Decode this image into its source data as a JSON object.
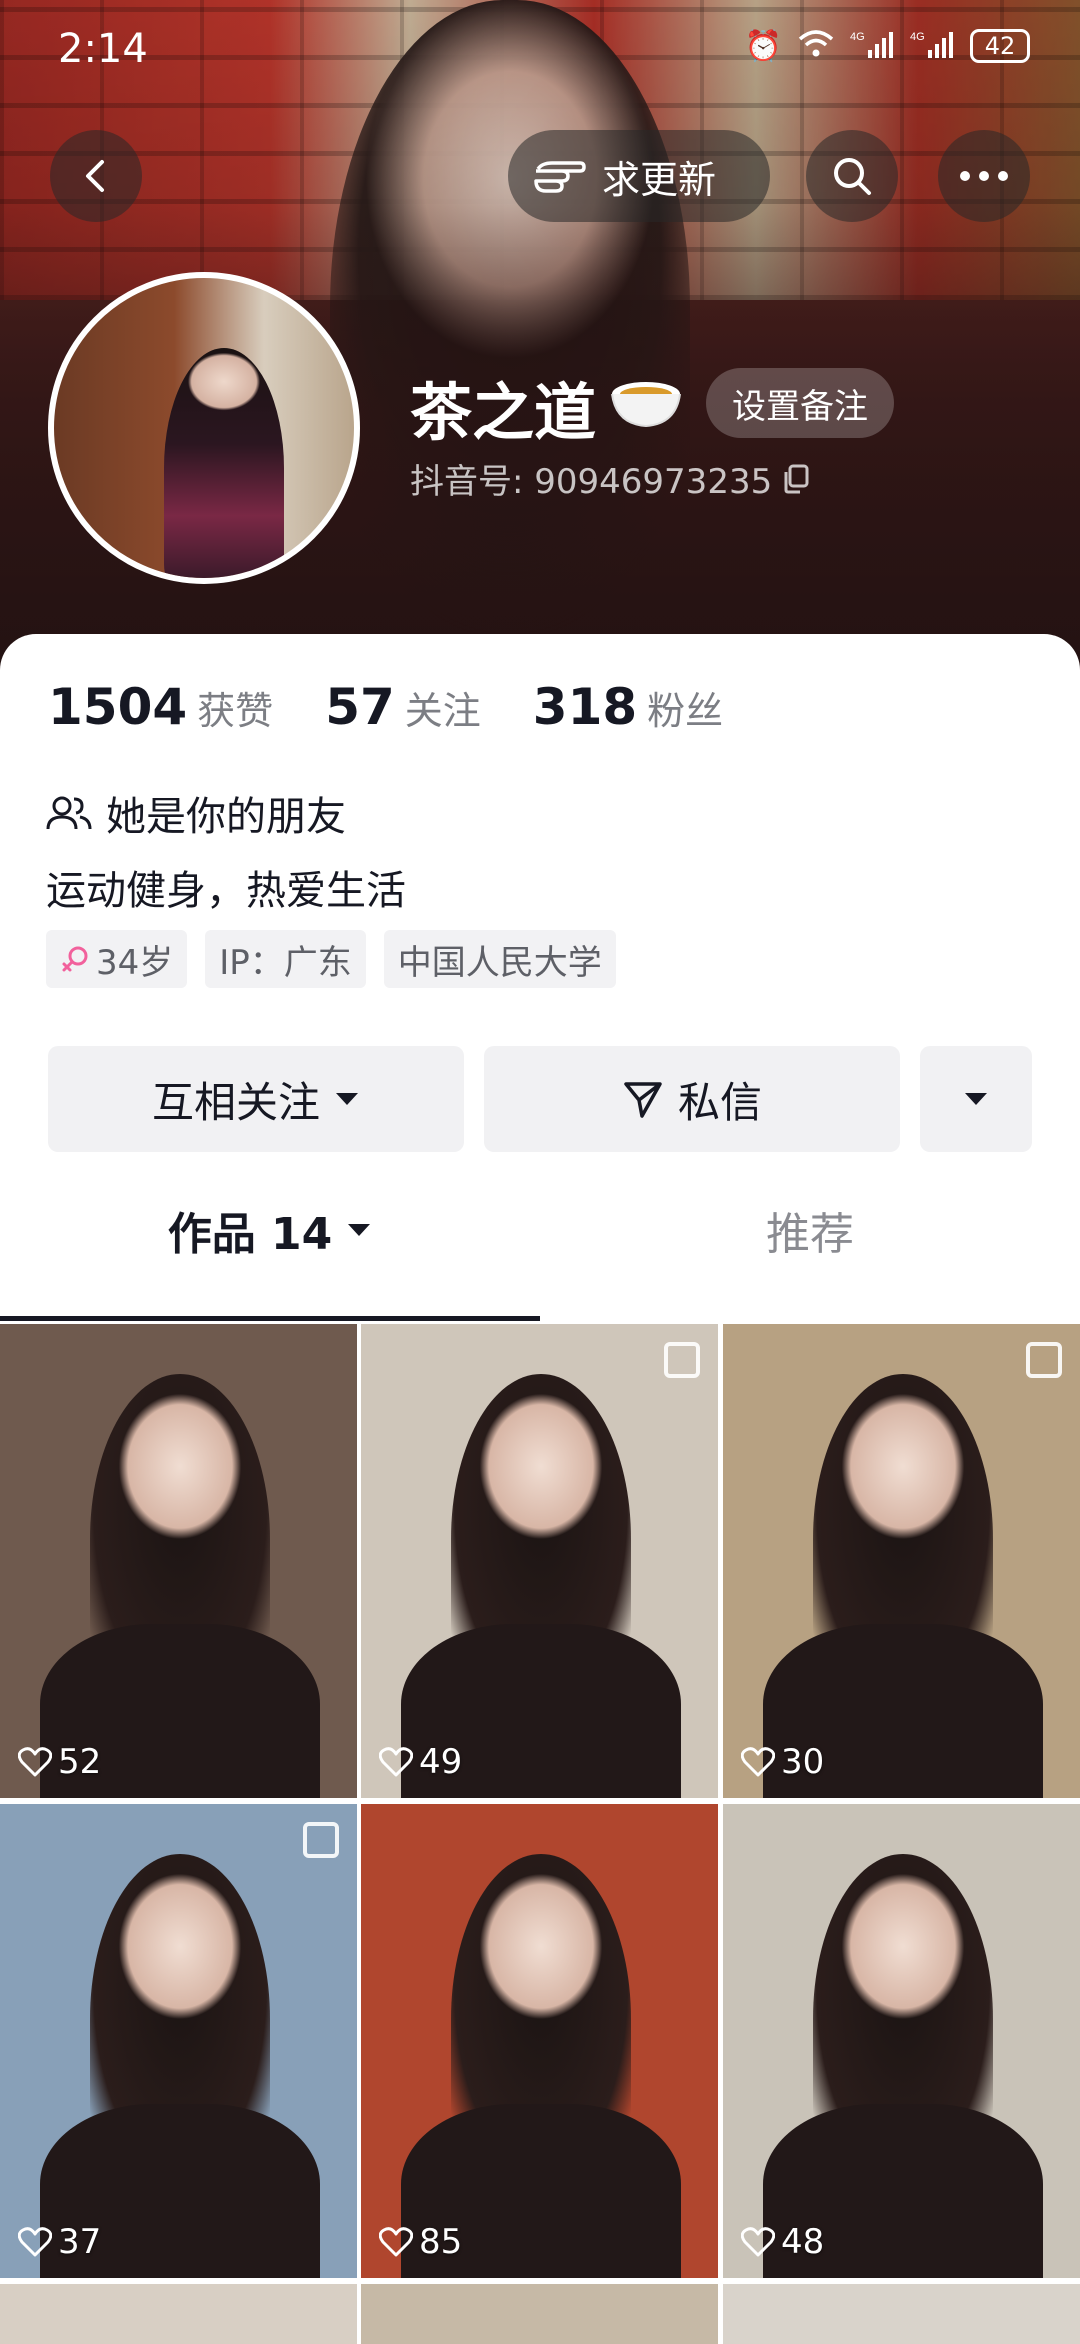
{
  "status_bar": {
    "time": "2:14",
    "battery": "42",
    "signal1": "4G",
    "signal2": "4G"
  },
  "nav": {
    "update_label": "求更新"
  },
  "profile": {
    "nickname": "茶之道",
    "remark_label": "设置备注",
    "douyin_id": "抖音号: 90946973235"
  },
  "stats": [
    {
      "value": "1504",
      "label": "获赞"
    },
    {
      "value": "57",
      "label": "关注"
    },
    {
      "value": "318",
      "label": "粉丝"
    }
  ],
  "friend_text": "她是你的朋友",
  "bio": "运动健身，热爱生活",
  "tags": {
    "age": "34岁",
    "ip": "IP：广东",
    "school": "中国人民大学"
  },
  "actions": {
    "follow": "互相关注",
    "message": "私信"
  },
  "tabs": {
    "works": "作品 14",
    "recommend": "推荐"
  },
  "grid": [
    {
      "likes": "52",
      "bg": "#6f5a4e"
    },
    {
      "likes": "49",
      "bg": "#cfc6ba"
    },
    {
      "likes": "30",
      "bg": "#b7a182"
    },
    {
      "likes": "37",
      "bg": "#88a0b8"
    },
    {
      "likes": "85",
      "bg": "#b0462e"
    },
    {
      "likes": "48",
      "bg": "#c9c3b8"
    }
  ],
  "colors": {
    "accent": "#161823",
    "female": "#f2619c",
    "muted": "#7c7e84"
  }
}
